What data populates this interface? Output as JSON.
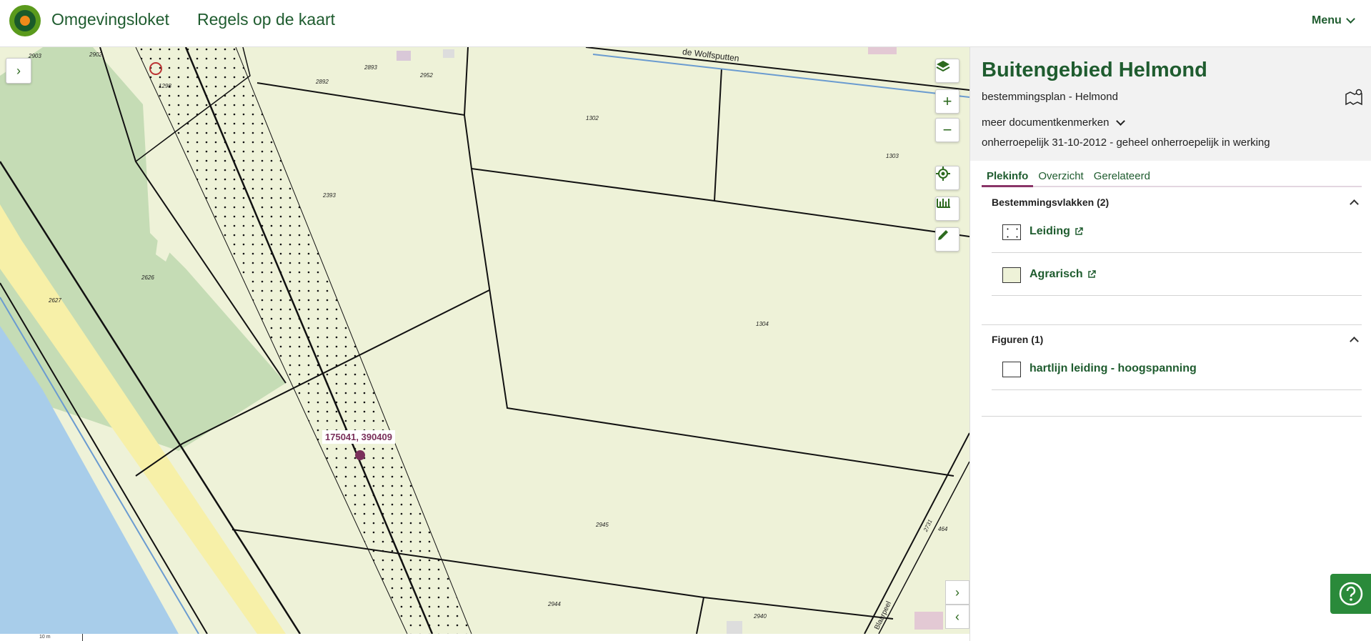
{
  "header": {
    "brand": "Omgevingsloket",
    "app_title": "Regels op de kaart",
    "menu_label": "Menu"
  },
  "map": {
    "coordinate_label": "175041, 390409",
    "street_label": "de Wolfsputten",
    "street_label_2": "Blaarpeel",
    "scale_label": "10 m",
    "parcels": [
      "2903",
      "2902",
      "1298",
      "2892",
      "2893",
      "2952",
      "1302",
      "1303",
      "2393",
      "2626",
      "2627",
      "1304",
      "2945",
      "2944",
      "2940",
      "464",
      "2731"
    ]
  },
  "plan": {
    "title": "Buitengebied Helmond",
    "subtitle": "bestemmingsplan - Helmond",
    "more_label": "meer documentkenmerken",
    "status": "onherroepelijk 31-10-2012 - geheel onherroepelijk in werking"
  },
  "tabs": [
    {
      "label": "Plekinfo"
    },
    {
      "label": "Overzicht"
    },
    {
      "label": "Gerelateerd"
    }
  ],
  "bestemmingsvlakken": {
    "title": "Bestemmingsvlakken (2)",
    "items": [
      {
        "label": "Leiding"
      },
      {
        "label": "Agrarisch"
      }
    ]
  },
  "figuren": {
    "title": "Figuren (1)",
    "items": [
      {
        "label": "hartlijn leiding - hoogspanning"
      }
    ]
  },
  "colors": {
    "brand_green": "#1f5c2f",
    "accent_purple": "#8a3468",
    "agrarisch": "#eef2d8",
    "water": "#a8cdea",
    "forest": "#c5dcb5",
    "road_yellow": "#f7f0a8"
  }
}
